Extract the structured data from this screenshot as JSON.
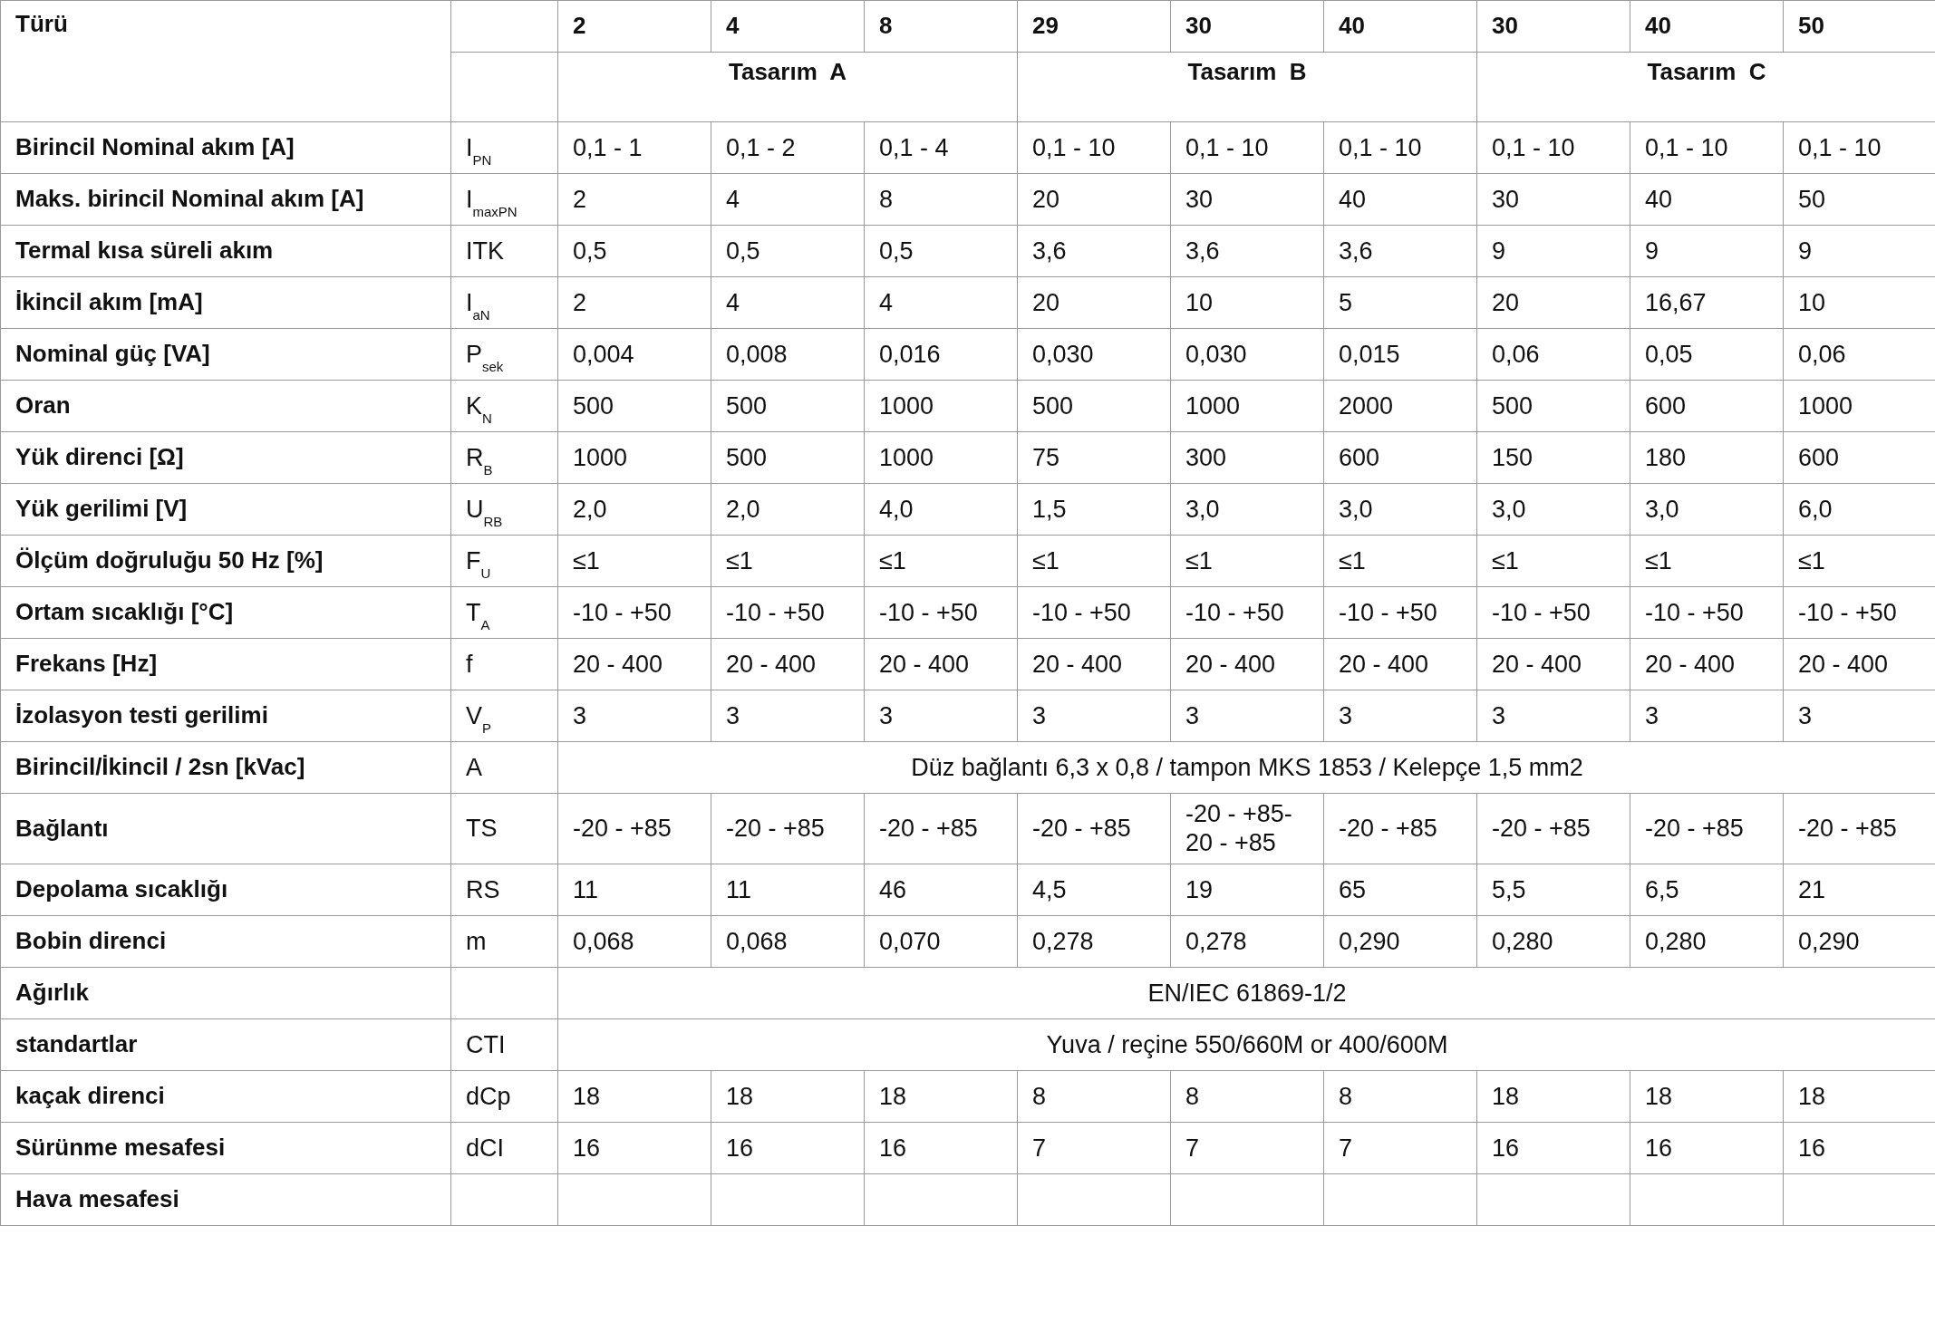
{
  "table": {
    "header": {
      "label": "Türü",
      "designs": [
        {
          "label": "Tasarım  A",
          "types": [
            "2",
            "4",
            "8"
          ]
        },
        {
          "label": "Tasarım  B",
          "types": [
            "29",
            "30",
            "40"
          ]
        },
        {
          "label": "Tasarım  C",
          "types": [
            "30",
            "40",
            "50"
          ]
        }
      ]
    },
    "rows": [
      {
        "kind": "values",
        "label": "Birincil Nominal akım [A]",
        "symbol": "I$_{PN}$",
        "cells": [
          "0,1 - 1",
          "0,1 - 2",
          "0,1 - 4",
          "0,1 - 10",
          "0,1 - 10",
          "0,1 - 10",
          "0,1 - 10",
          "0,1 - 10",
          "0,1 - 10"
        ]
      },
      {
        "kind": "values",
        "label": "Maks. birincil Nominal akım [A]",
        "symbol": "I$_{maxPN}$",
        "cells": [
          "2",
          "4",
          "8",
          "20",
          "30",
          "40",
          "30",
          "40",
          "50"
        ]
      },
      {
        "kind": "values",
        "label": "Termal kısa süreli akım",
        "symbol": "ITK",
        "cells": [
          "0,5",
          "0,5",
          "0,5",
          "3,6",
          "3,6",
          "3,6",
          "9",
          "9",
          "9"
        ]
      },
      {
        "kind": "values",
        "label": "İkincil akım [mA]",
        "symbol": "I$_{aN}$",
        "cells": [
          "2",
          "4",
          "4",
          "20",
          "10",
          "5",
          "20",
          "16,67",
          "10"
        ]
      },
      {
        "kind": "values",
        "label": "Nominal güç [VA]",
        "symbol": "P$_{sek}$",
        "cells": [
          "0,004",
          "0,008",
          "0,016",
          "0,030",
          "0,030",
          "0,015",
          "0,06",
          "0,05",
          "0,06"
        ]
      },
      {
        "kind": "values",
        "label": "Oran",
        "symbol": "K$_{N}$",
        "cells": [
          "500",
          "500",
          "1000",
          "500",
          "1000",
          "2000",
          "500",
          "600",
          "1000"
        ]
      },
      {
        "kind": "values",
        "label": "Yük direnci [Ω]",
        "symbol": "R$_{B}$",
        "cells": [
          "1000",
          "500",
          "1000",
          "75",
          "300",
          "600",
          "150",
          "180",
          "600"
        ]
      },
      {
        "kind": "values",
        "label": "Yük gerilimi [V]",
        "symbol": "U$_{RB}$",
        "cells": [
          "2,0",
          "2,0",
          "4,0",
          "1,5",
          "3,0",
          "3,0",
          "3,0",
          "3,0",
          "6,0"
        ]
      },
      {
        "kind": "values",
        "label": "Ölçüm doğruluğu 50 Hz [%]",
        "symbol": "F$_{U}$",
        "cells": [
          "≤1",
          "≤1",
          "≤1",
          "≤1",
          "≤1",
          "≤1",
          "≤1",
          "≤1",
          "≤1"
        ]
      },
      {
        "kind": "values",
        "label": "Ortam sıcaklığı [°C]",
        "symbol": "T$_{A}$",
        "cells": [
          "-10 - +50",
          "-10 - +50",
          "-10 - +50",
          "-10 - +50",
          "-10 - +50",
          "-10 - +50",
          "-10 - +50",
          "-10 - +50",
          "-10 - +50"
        ]
      },
      {
        "kind": "values",
        "label": "Frekans [Hz]",
        "symbol": "f",
        "cells": [
          "20 - 400",
          "20 - 400",
          "20 - 400",
          "20 - 400",
          "20 - 400",
          "20 - 400",
          "20 - 400",
          "20 - 400",
          "20 - 400"
        ]
      },
      {
        "kind": "values",
        "label": "İzolasyon testi gerilimi",
        "symbol": "V$_{P}$",
        "cells": [
          "3",
          "3",
          "3",
          "3",
          "3",
          "3",
          "3",
          "3",
          "3"
        ]
      },
      {
        "kind": "merged",
        "label": "Birincil/İkincil / 2sn [kVac]",
        "symbol": "A",
        "text": "Düz bağlantı 6,3 x 0,8 / tampon MKS 1853 / Kelepçe 1,5 mm2"
      },
      {
        "kind": "values",
        "label": "Bağlantı",
        "symbol": "TS",
        "cells": [
          "-20 - +85",
          "-20 - +85",
          "-20 - +85",
          "-20 - +85",
          "-20 - +85-20 - +85",
          "-20 - +85",
          "-20 - +85",
          "-20 - +85",
          "-20 - +85"
        ]
      },
      {
        "kind": "values",
        "label": "Depolama sıcaklığı",
        "symbol": "RS",
        "cells": [
          "11",
          "11",
          "46",
          "4,5",
          "19",
          "65",
          "5,5",
          "6,5",
          "21"
        ]
      },
      {
        "kind": "values",
        "label": "Bobin direnci",
        "symbol": "m",
        "cells": [
          "0,068",
          "0,068",
          "0,070",
          "0,278",
          "0,278",
          "0,290",
          "0,280",
          "0,280",
          "0,290"
        ]
      },
      {
        "kind": "merged",
        "label": "Ağırlık",
        "text": "EN/IEC 61869-1/2"
      },
      {
        "kind": "merged",
        "label": "standartlar",
        "symbol": "CTI",
        "text": "Yuva / reçine 550/660M or 400/600M"
      },
      {
        "kind": "values",
        "label": "kaçak direnci",
        "symbol": "dCp",
        "cells": [
          "18",
          "18",
          "18",
          "8",
          "8",
          "8",
          "18",
          "18",
          "18"
        ]
      },
      {
        "kind": "values",
        "label": "Sürünme mesafesi",
        "symbol": "dCI",
        "cells": [
          "16",
          "16",
          "16",
          "7",
          "7",
          "7",
          "16",
          "16",
          "16"
        ]
      },
      {
        "kind": "empty",
        "label": "Hava mesafesi"
      }
    ]
  }
}
